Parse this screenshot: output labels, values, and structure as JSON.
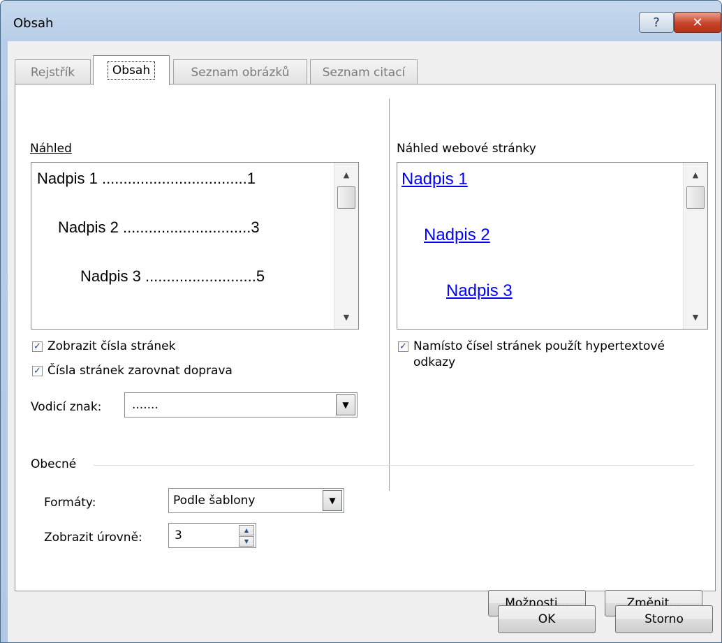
{
  "window": {
    "title": "Obsah",
    "help_label": "?",
    "close_label": "✕"
  },
  "tabs": [
    {
      "label": "Rejstřík",
      "active": false
    },
    {
      "label": "Obsah",
      "active": true
    },
    {
      "label": "Seznam obrázků",
      "active": false
    },
    {
      "label": "Seznam citací",
      "active": false
    }
  ],
  "print_preview": {
    "label": "Náhled",
    "entries": [
      {
        "text": "Nadpis 1",
        "page": "1"
      },
      {
        "text": "Nadpis 2",
        "page": "3"
      },
      {
        "text": "Nadpis 3",
        "page": "5"
      }
    ]
  },
  "web_preview": {
    "label": "Náhled webové stránky",
    "entries": [
      "Nadpis 1",
      "Nadpis 2",
      "Nadpis 3"
    ]
  },
  "options": {
    "show_page_numbers": {
      "label": "Zobrazit čísla stránek",
      "checked": true
    },
    "right_align": {
      "label": "Čísla stránek zarovnat doprava",
      "checked": true
    },
    "use_hyperlinks": {
      "label_line1": "Namísto čísel stránek použít hypertextové",
      "label_line2": "odkazy",
      "checked": true
    },
    "leader_label": "Vodicí znak:",
    "leader_value": "......."
  },
  "general": {
    "section_label": "Obecné",
    "formats_label": "Formáty:",
    "formats_value": "Podle šablony",
    "levels_label": "Zobrazit úrovně:",
    "levels_value": "3"
  },
  "buttons": {
    "options": "Možnosti...",
    "modify": "Změnit...",
    "ok": "OK",
    "cancel": "Storno"
  }
}
